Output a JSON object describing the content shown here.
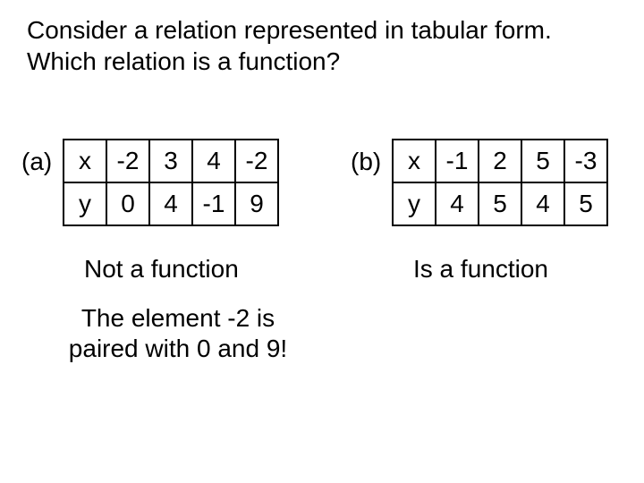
{
  "question": "Consider a relation represented in tabular form. Which relation is a function?",
  "partA": {
    "label": "(a)",
    "rows": [
      {
        "head": "x",
        "vals": [
          "-2",
          "3",
          "4",
          "-2"
        ]
      },
      {
        "head": "y",
        "vals": [
          "0",
          "4",
          "-1",
          "9"
        ]
      }
    ],
    "verdict": "Not a function",
    "explain": "The element -2 is paired with 0 and 9!"
  },
  "partB": {
    "label": "(b)",
    "rows": [
      {
        "head": "x",
        "vals": [
          "-1",
          "2",
          "5",
          "-3"
        ]
      },
      {
        "head": "y",
        "vals": [
          "4",
          "5",
          "4",
          "5"
        ]
      }
    ],
    "verdict": "Is a function"
  },
  "chart_data": [
    {
      "type": "table",
      "title": "(a)",
      "categories": [
        "x",
        "y"
      ],
      "series": [
        {
          "name": "col1",
          "values": [
            -2,
            0
          ]
        },
        {
          "name": "col2",
          "values": [
            3,
            4
          ]
        },
        {
          "name": "col3",
          "values": [
            4,
            -1
          ]
        },
        {
          "name": "col4",
          "values": [
            -2,
            9
          ]
        }
      ]
    },
    {
      "type": "table",
      "title": "(b)",
      "categories": [
        "x",
        "y"
      ],
      "series": [
        {
          "name": "col1",
          "values": [
            -1,
            4
          ]
        },
        {
          "name": "col2",
          "values": [
            2,
            5
          ]
        },
        {
          "name": "col3",
          "values": [
            5,
            4
          ]
        },
        {
          "name": "col4",
          "values": [
            -3,
            5
          ]
        }
      ]
    }
  ]
}
